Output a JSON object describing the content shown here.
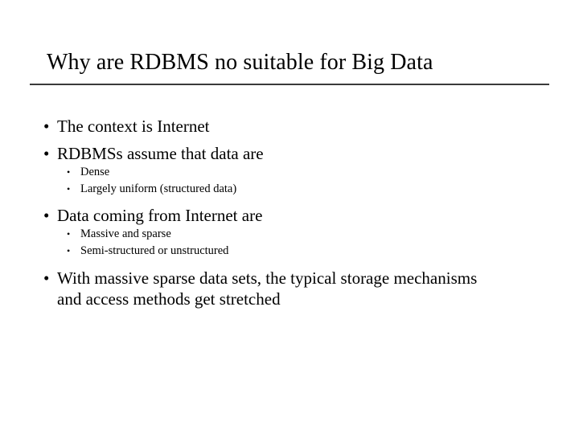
{
  "slide": {
    "title": "Why are RDBMS no suitable for Big Data",
    "background_color": "#ffffff",
    "text_color": "#000000",
    "rule_color": "#3a3a3a",
    "bullet_glyph": "•",
    "sub_bullet_glyph": "•",
    "body": {
      "items": [
        {
          "level": 1,
          "text": "The context is Internet"
        },
        {
          "level": 1,
          "text": "RDBMSs assume that data are"
        },
        {
          "level": 2,
          "text": "Dense"
        },
        {
          "level": 2,
          "text": "Largely uniform (structured data)"
        },
        {
          "level": 1,
          "text": "Data coming from Internet are"
        },
        {
          "level": 2,
          "text": "Massive and sparse"
        },
        {
          "level": 2,
          "text": "Semi-structured or unstructured"
        },
        {
          "level": 1,
          "text": "With massive sparse data sets, the typical storage mechanisms and access methods get stretched"
        }
      ]
    }
  }
}
